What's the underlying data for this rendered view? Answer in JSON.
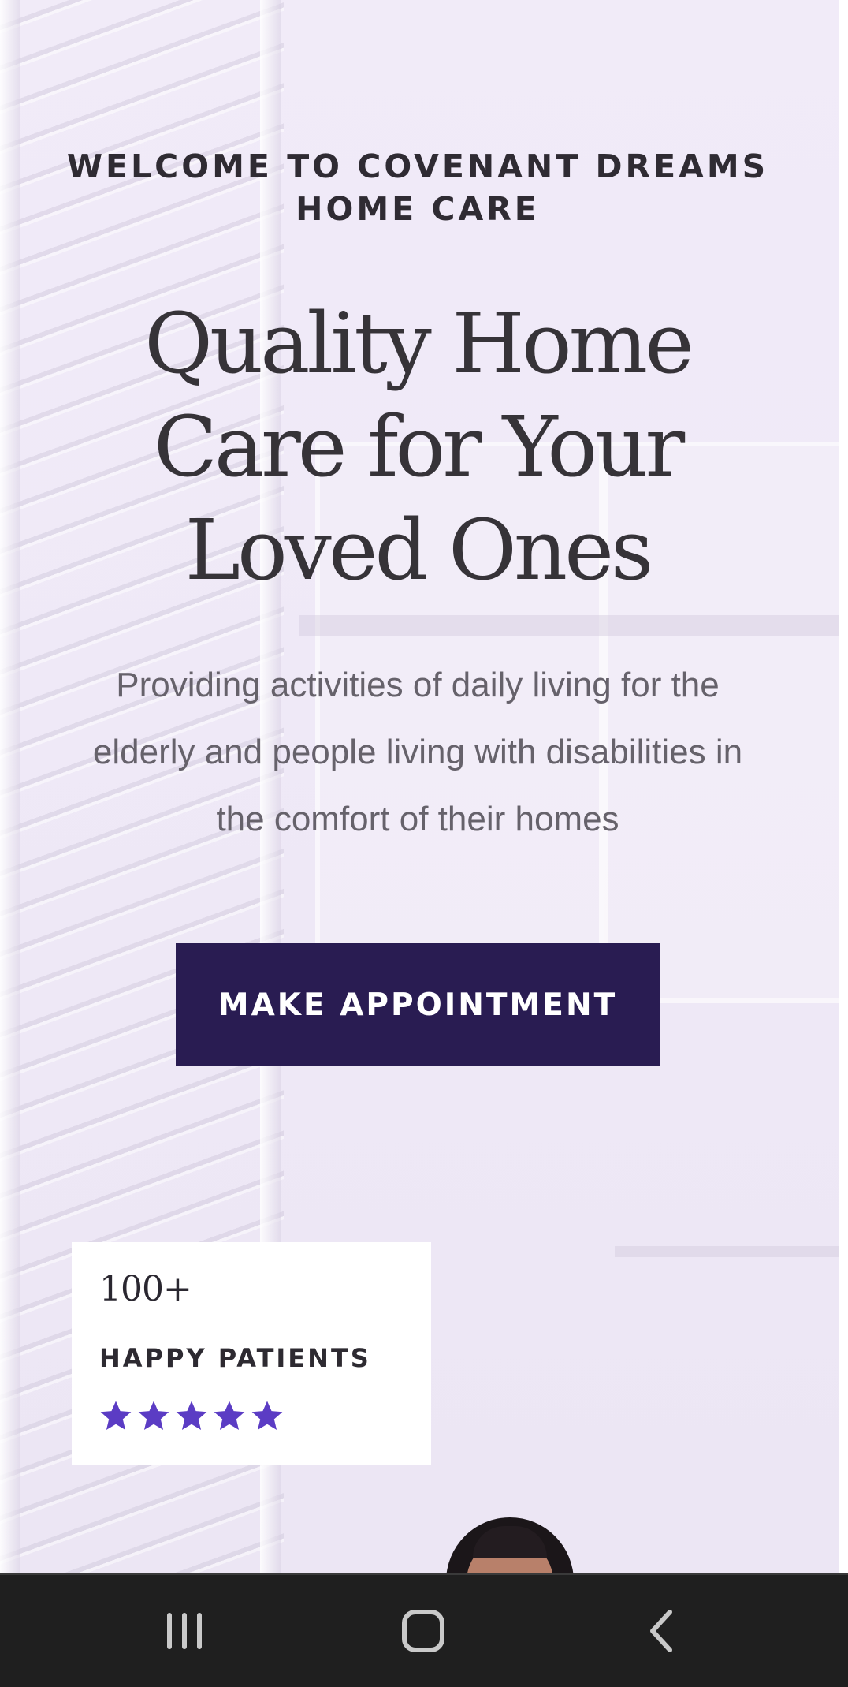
{
  "hero": {
    "eyebrow": "WELCOME TO COVENANT DREAMS HOME CARE",
    "headline": "Quality Home Care for Your Loved Ones",
    "subtitle": "Providing activities of daily living for the elderly and people living with disabilities in the comfort of their homes",
    "cta_label": "MAKE APPOINTMENT"
  },
  "stats": {
    "count": "100+",
    "label": "HAPPY PATIENTS",
    "rating": 5,
    "rating_max": 5,
    "star_color": "#5b3cc4"
  },
  "colors": {
    "cta_background": "#291c52",
    "hero_background": "#f1ebf8",
    "navbar_background": "#1f1f1f"
  },
  "system_nav": {
    "buttons": [
      "recent-apps-icon",
      "home-icon",
      "back-icon"
    ]
  }
}
